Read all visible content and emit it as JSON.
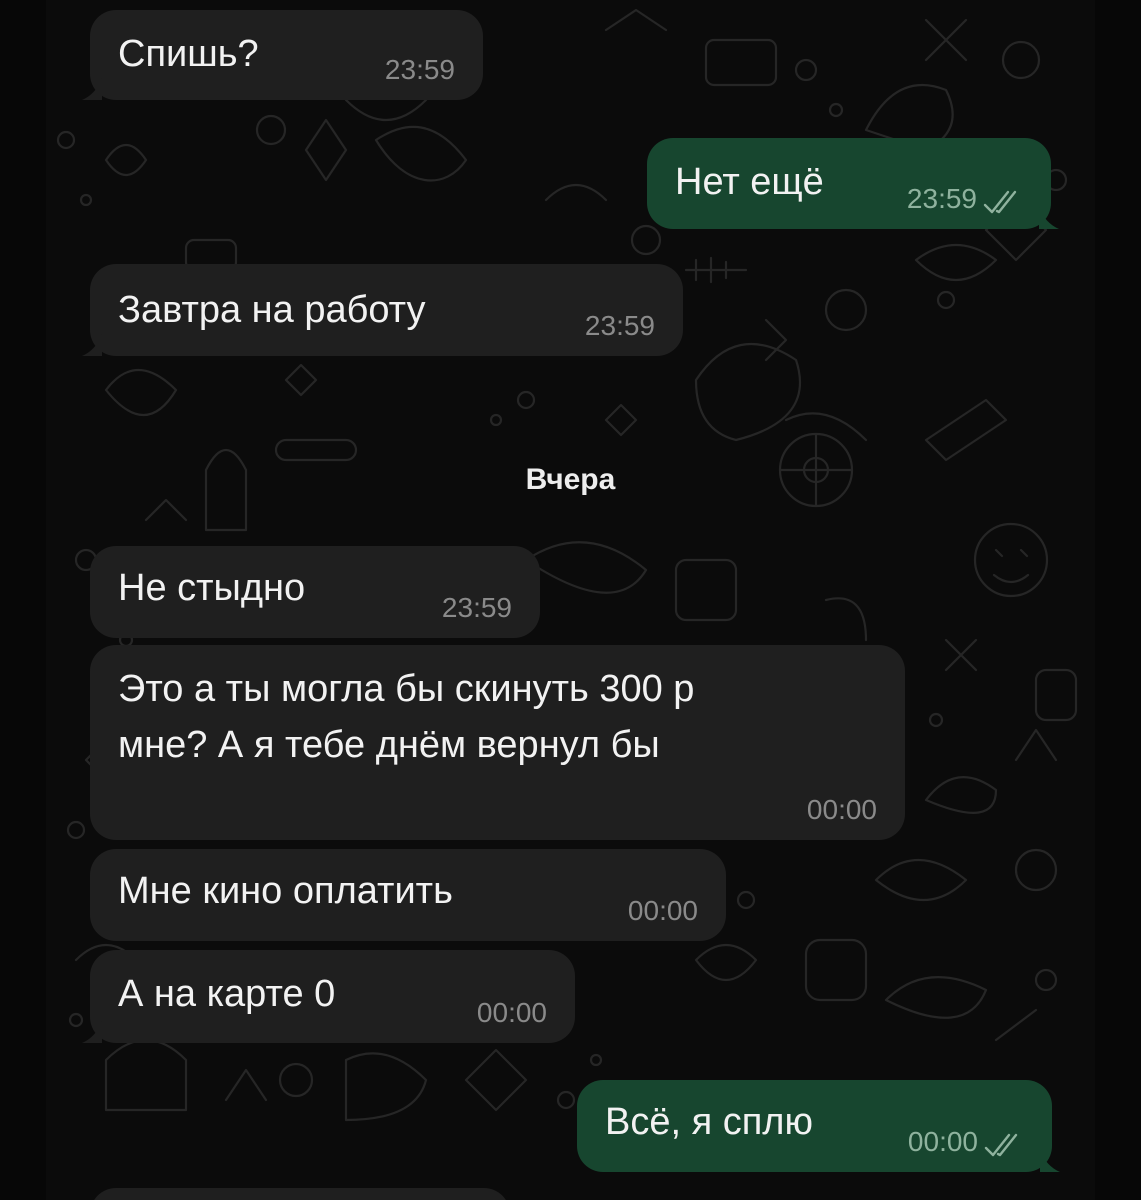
{
  "colors": {
    "background": "#0b0b0b",
    "incoming_bubble": "#1f1f1f",
    "outgoing_bubble": "#17462f",
    "text": "#f2f2f2",
    "time_incoming": "#8a8a8a",
    "time_outgoing": "#8fb29e"
  },
  "date_separator": "Вчера",
  "messages": [
    {
      "direction": "in",
      "text": "Спишь?",
      "time": "23:59"
    },
    {
      "direction": "out",
      "text": "Нет ещё",
      "time": "23:59",
      "status_icon": "double-check-icon"
    },
    {
      "direction": "in",
      "text": "Завтра на работу",
      "time": "23:59"
    },
    {
      "direction": "in",
      "text": "Не стыдно",
      "time": "23:59"
    },
    {
      "direction": "in",
      "text_lines": [
        "Это а ты могла бы скинуть 300 р",
        "мне? А я тебе днём вернул бы"
      ],
      "time": "00:00"
    },
    {
      "direction": "in",
      "text": "Мне кино оплатить",
      "time": "00:00"
    },
    {
      "direction": "in",
      "text": "А на карте 0",
      "time": "00:00"
    },
    {
      "direction": "out",
      "text": "Всё, я сплю",
      "time": "00:00",
      "status_icon": "double-check-icon"
    }
  ]
}
